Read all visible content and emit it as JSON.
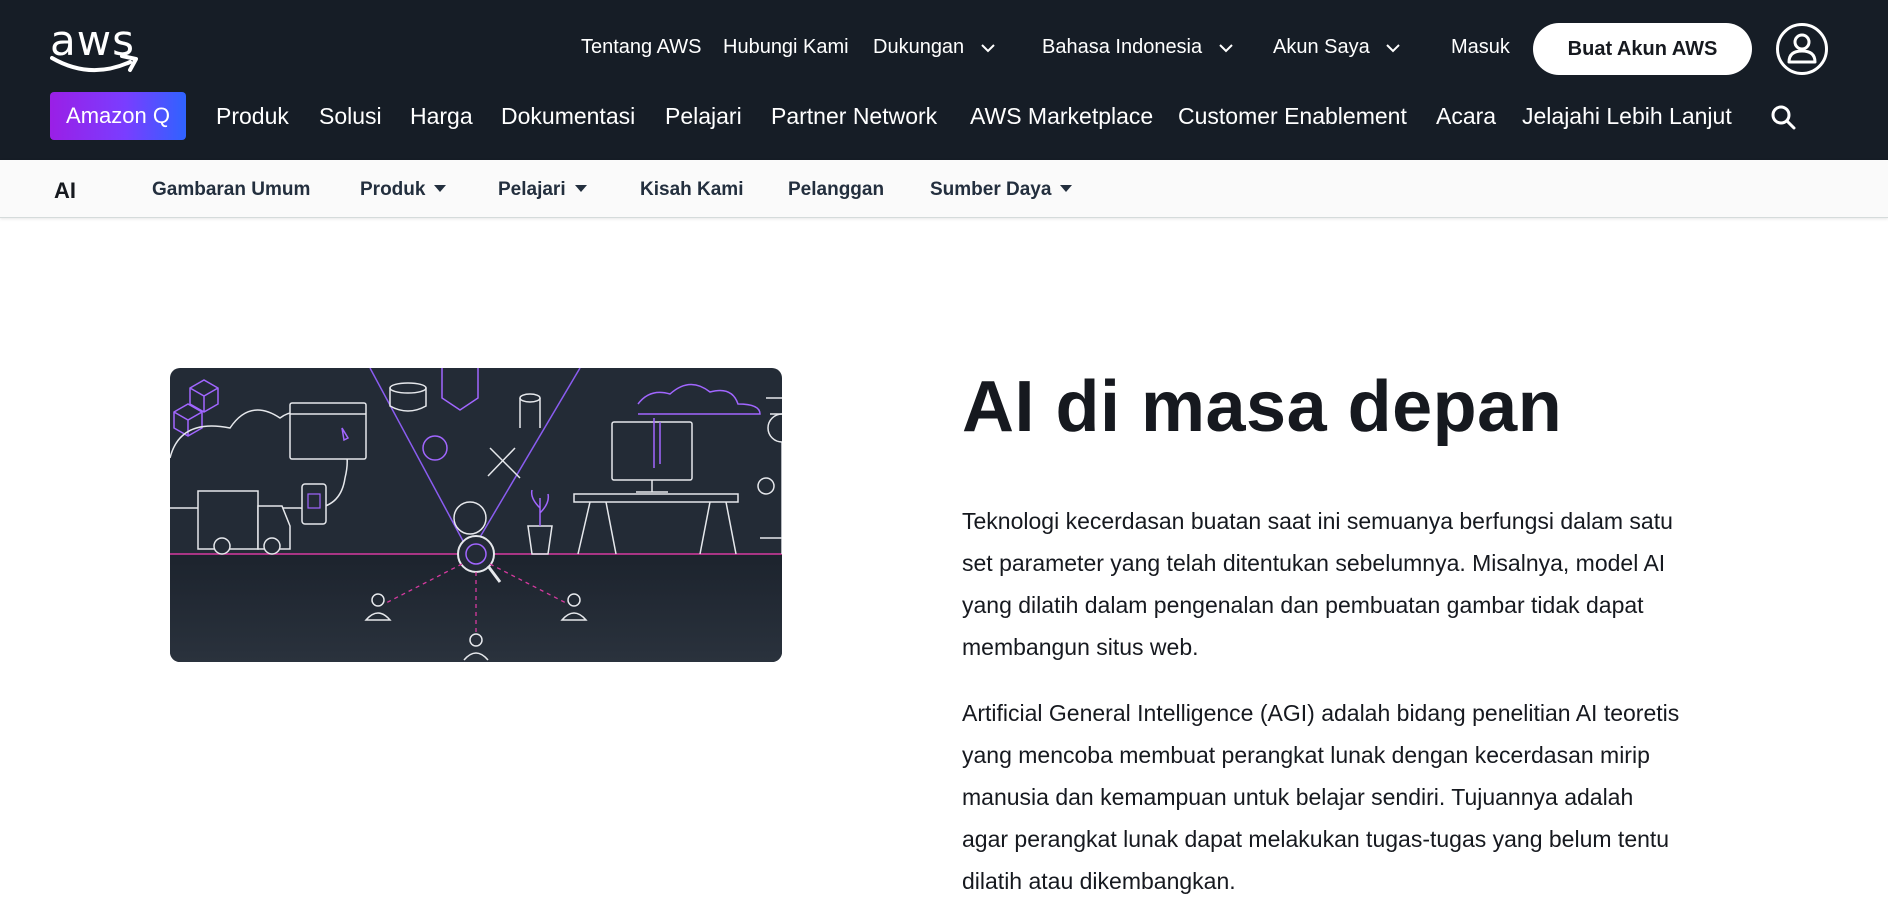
{
  "header": {
    "logo_text": "aws",
    "utility_links": {
      "about": "Tentang AWS",
      "contact": "Hubungi Kami",
      "support": "Dukungan",
      "language": "Bahasa Indonesia",
      "account": "Akun Saya",
      "sign_in": "Masuk"
    },
    "create_account_label": "Buat Akun AWS",
    "amazon_q_label": "Amazon Q",
    "main_nav": {
      "products": "Produk",
      "solutions": "Solusi",
      "pricing": "Harga",
      "documentation": "Dokumentasi",
      "learn": "Pelajari",
      "partner_network": "Partner Network",
      "marketplace": "AWS Marketplace",
      "customer_enablement": "Customer Enablement",
      "events": "Acara",
      "explore_more": "Jelajahi Lebih Lanjut"
    },
    "icons": {
      "user": "user-icon",
      "search": "search-icon",
      "chevron": "chevron-down-icon"
    }
  },
  "subnav": {
    "title": "AI",
    "items": {
      "overview": "Gambaran Umum",
      "products": "Produk",
      "learn": "Pelajari",
      "our_story": "Kisah Kami",
      "customers": "Pelanggan",
      "resources": "Sumber Daya"
    }
  },
  "main": {
    "headline": "AI di masa depan",
    "paragraphs": [
      "Teknologi kecerdasan buatan saat ini semuanya berfungsi dalam satu set parameter yang telah ditentukan sebelumnya. Misalnya, model AI yang dilatih dalam pengenalan dan pembuatan gambar tidak dapat membangun situs web.",
      "Artificial General Intelligence (AGI) adalah bidang penelitian AI teoretis yang mencoba membuat perangkat lunak dengan kecerdasan mirip manusia dan kemampuan untuk belajar sendiri. Tujuannya adalah agar perangkat lunak dapat melakukan tugas-tugas yang belum tentu dilatih atau dikembangkan."
    ]
  },
  "colors": {
    "header_bg": "#161d26",
    "subnav_bg": "#fafafa",
    "text_primary": "#16191f",
    "amazon_q_gradient_start": "#9a1fe6",
    "amazon_q_gradient_end": "#2f63ff",
    "illustration_bg": "#232b36",
    "illustration_accent": "#a166ff",
    "illustration_line": "#d63aa0"
  }
}
